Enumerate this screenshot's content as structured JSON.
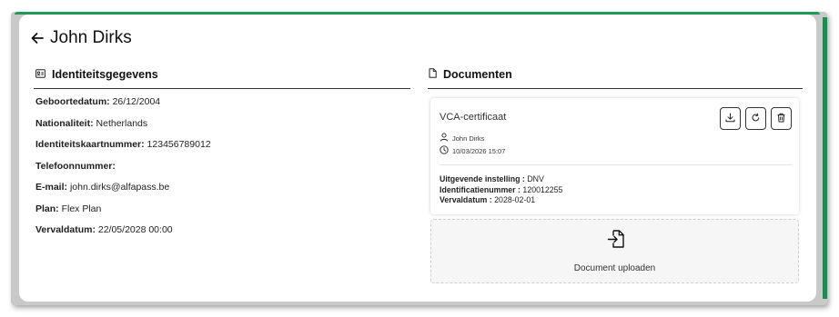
{
  "header": {
    "title": "John Dirks"
  },
  "identity": {
    "heading": "Identiteitsgegevens",
    "fields": [
      {
        "label": "Geboortedatum:",
        "value": "26/12/2004"
      },
      {
        "label": "Nationaliteit:",
        "value": "Netherlands"
      },
      {
        "label": "Identiteitskaartnummer:",
        "value": "123456789012"
      },
      {
        "label": "Telefoonnummer:",
        "value": ""
      },
      {
        "label": "E-mail:",
        "value": "john.dirks@alfapass.be"
      },
      {
        "label": "Plan:",
        "value": "Flex Plan"
      },
      {
        "label": "Vervaldatum:",
        "value": "22/05/2028 00:00"
      }
    ]
  },
  "documents": {
    "heading": "Documenten",
    "items": [
      {
        "name": "VCA-certificaat",
        "owner": "John Dirks",
        "timestamp": "10/03/2026 15:07",
        "details": [
          {
            "label": "Uitgevende instelling :",
            "value": "DNV"
          },
          {
            "label": "Identificatienummer :",
            "value": "120012255"
          },
          {
            "label": "Vervaldatum :",
            "value": "2028-02-01"
          }
        ]
      }
    ],
    "upload_label": "Document uploaden"
  },
  "colors": {
    "accent": "#1f9a5a",
    "text": "#1f1f1f",
    "upload_bg": "#f6f6f6"
  },
  "icons": [
    "arrow-left-icon",
    "id-card-icon",
    "document-icon",
    "user-icon",
    "clock-icon",
    "download-icon",
    "refresh-icon",
    "trash-icon",
    "file-import-icon"
  ]
}
